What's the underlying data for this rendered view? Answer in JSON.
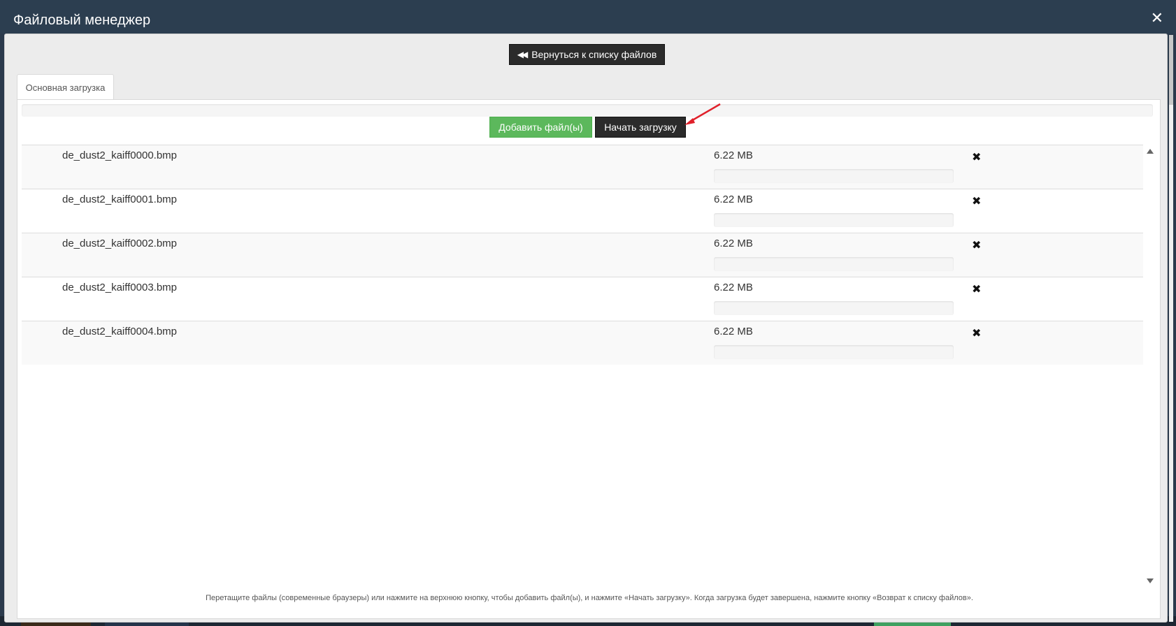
{
  "window": {
    "title": "Файловый менеджер"
  },
  "toolbar": {
    "back_label": "Вернуться к списку файлов",
    "add_label": "Добавить файл(ы)",
    "start_label": "Начать загрузку"
  },
  "tabs": [
    {
      "label": "Основная загрузка",
      "active": true
    }
  ],
  "files": [
    {
      "name": "de_dust2_kaiff0000.bmp",
      "size": "6.22 MB",
      "progress": 0
    },
    {
      "name": "de_dust2_kaiff0001.bmp",
      "size": "6.22 MB",
      "progress": 0
    },
    {
      "name": "de_dust2_kaiff0002.bmp",
      "size": "6.22 MB",
      "progress": 0
    },
    {
      "name": "de_dust2_kaiff0003.bmp",
      "size": "6.22 MB",
      "progress": 0
    },
    {
      "name": "de_dust2_kaiff0004.bmp",
      "size": "6.22 MB",
      "progress": 0
    }
  ],
  "hint": "Перетащите файлы (современные браузеры) или нажмите на верхнюю кнопку, чтобы добавить файл(ы), и нажмите «Начать загрузку». Когда загрузка будет завершена, нажмите кнопку «Возврат к списку файлов».",
  "icons": {
    "close": "close-icon",
    "back": "double-chevron-left-icon",
    "remove": "remove-icon",
    "annotation": "red-arrow-icon"
  },
  "colors": {
    "titlebar": "#2c3e50",
    "add_button": "#5cb85c",
    "dark_button": "#2b2b2b",
    "annotation_arrow": "#e0202a"
  }
}
